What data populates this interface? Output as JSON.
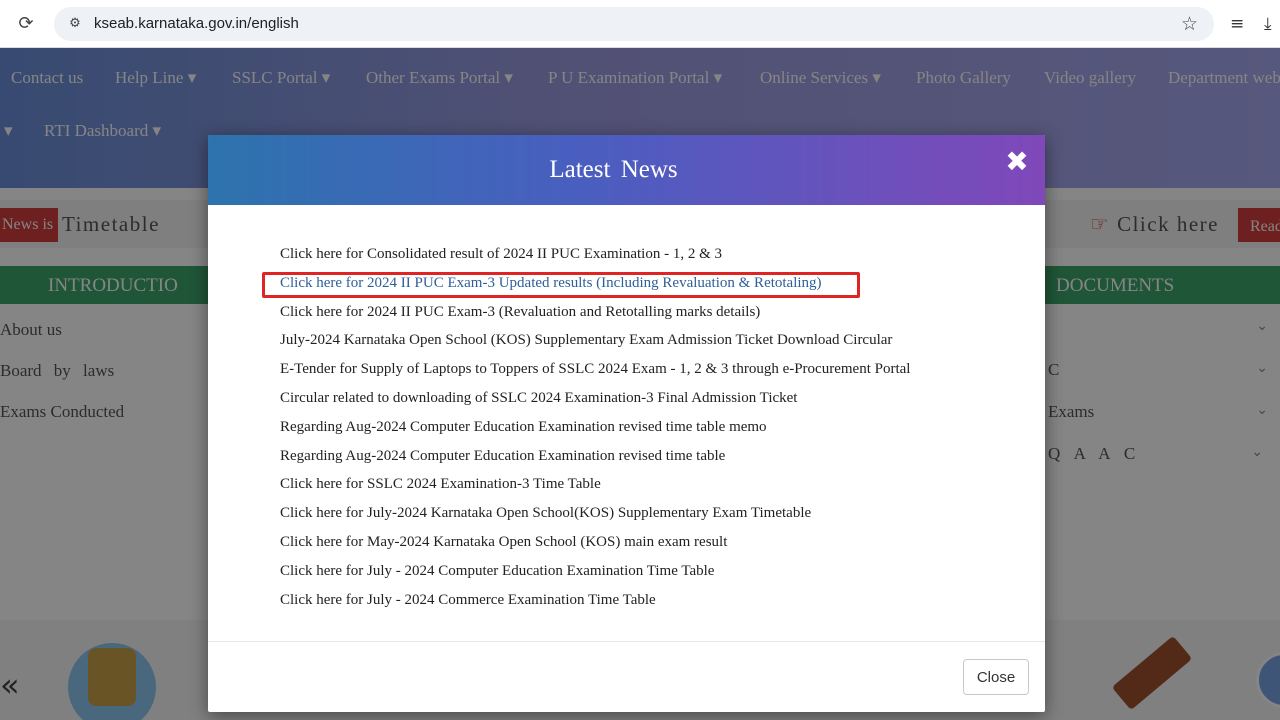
{
  "browser": {
    "url": "kseab.karnataka.gov.in/english",
    "icons": {
      "reload": "reload-icon",
      "site_info": "site-info-icon",
      "bookmark": "star-icon",
      "reading_list": "reading-list-icon",
      "download": "download-icon"
    }
  },
  "nav": {
    "row1": [
      "Contact us",
      "Help Line ▾",
      "SSLC Portal ▾",
      "Other Exams Portal ▾",
      "P U Examination Portal ▾",
      "Online Services ▾",
      "Photo Gallery",
      "Video gallery",
      "Department web"
    ],
    "row2": [
      "▾",
      "RTI Dashboard ▾"
    ]
  },
  "ticker": {
    "badge": "News is",
    "text": "Timetable",
    "right_text": "Click here",
    "read": "Read"
  },
  "sidebar": {
    "heading": "INTRODUCTIO",
    "items": [
      "About us",
      "Board by laws",
      "Exams Conducted"
    ]
  },
  "documents": {
    "heading": "DOCUMENTS",
    "items": [
      "",
      "C",
      "Exams",
      "Q A A C"
    ]
  },
  "modal": {
    "title": "Latest News",
    "close_label": "Close",
    "news": [
      "Click here for Consolidated result of 2024 II PUC Examination - 1, 2 & 3",
      "Click here for 2024 II PUC Exam-3 Updated results (Including Revaluation & Retotaling)",
      "Click here for 2024 II PUC Exam-3 (Revaluation and Retotalling marks details)",
      "July-2024 Karnataka Open School (KOS) Supplementary Exam Admission Ticket Download Circular",
      "E-Tender for Supply of Laptops to Toppers of SSLC 2024 Exam - 1, 2 & 3 through e-Procurement Portal",
      "Circular related to downloading of SSLC 2024 Examination-3 Final Admission Ticket",
      "Regarding Aug-2024 Computer Education Examination revised time table memo",
      "Regarding Aug-2024 Computer Education Examination revised time table",
      "Click here for SSLC 2024 Examination-3 Time Table",
      "Click here for July-2024 Karnataka Open School(KOS) Supplementary Exam Timetable",
      "Click here for May-2024 Karnataka Open School (KOS) main exam result",
      "Click here for July - 2024 Computer Education Examination Time Table",
      "Click here for July - 2024 Commerce Examination Time Table"
    ]
  },
  "colors": {
    "highlight_border": "#e02424",
    "header_start": "#2d73ad",
    "header_end": "#8048b9"
  }
}
